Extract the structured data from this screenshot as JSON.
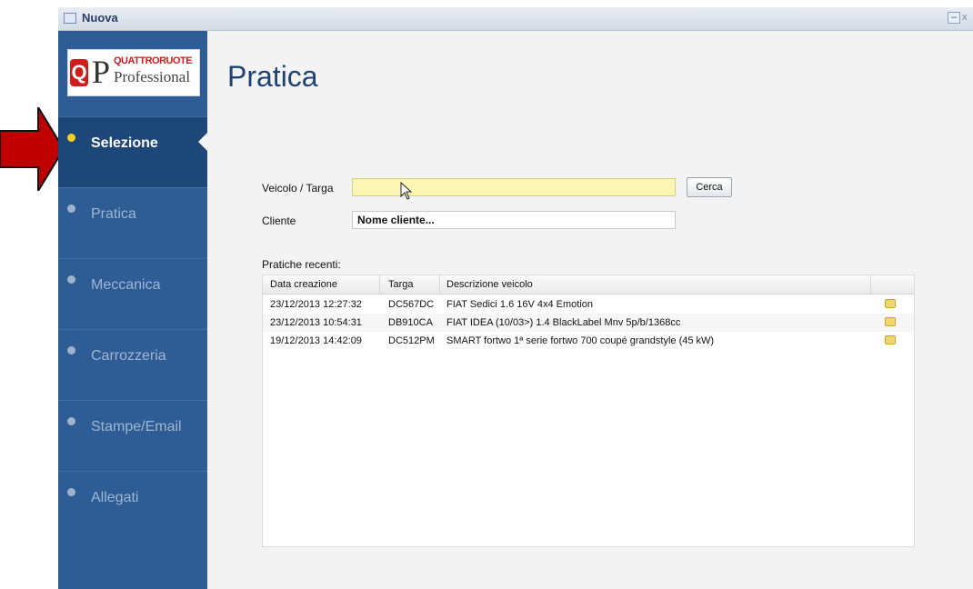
{
  "window": {
    "title": "Nuova",
    "min_label": "–",
    "close_label": "x"
  },
  "logo": {
    "q": "Q",
    "p": "P",
    "brand": "QUATTRORUOTE",
    "sub": "Professional"
  },
  "sidebar": {
    "items": [
      {
        "label": "Selezione",
        "active": true
      },
      {
        "label": "Pratica"
      },
      {
        "label": "Meccanica"
      },
      {
        "label": "Carrozzeria"
      },
      {
        "label": "Stampe/Email"
      },
      {
        "label": "Allegati"
      }
    ]
  },
  "main": {
    "title": "Pratica",
    "form": {
      "veicolo_label": "Veicolo / Targa",
      "veicolo_value": "",
      "cerca_label": "Cerca",
      "cliente_label": "Cliente",
      "cliente_value": "Nome cliente..."
    },
    "recent": {
      "label": "Pratiche recenti:",
      "columns": [
        "Data creazione",
        "Targa",
        "Descrizione veicolo"
      ],
      "rows": [
        {
          "date": "23/12/2013 12:27:32",
          "plate": "DC567DC",
          "desc": "FIAT Sedici 1.6 16V 4x4 Emotion"
        },
        {
          "date": "23/12/2013 10:54:31",
          "plate": "DB910CA",
          "desc": "FIAT IDEA (10/03>) 1.4 BlackLabel Mnv 5p/b/1368cc"
        },
        {
          "date": "19/12/2013 14:42:09",
          "plate": "DC512PM",
          "desc": "SMART fortwo 1ª serie fortwo 700 coupé grandstyle (45 kW)"
        }
      ]
    }
  },
  "colors": {
    "sidebar": "#2d5d94",
    "active_item": "#1d4679",
    "title": "#1e4372",
    "arrow": "#c00000",
    "input_highlight": "#fbf6b3"
  }
}
